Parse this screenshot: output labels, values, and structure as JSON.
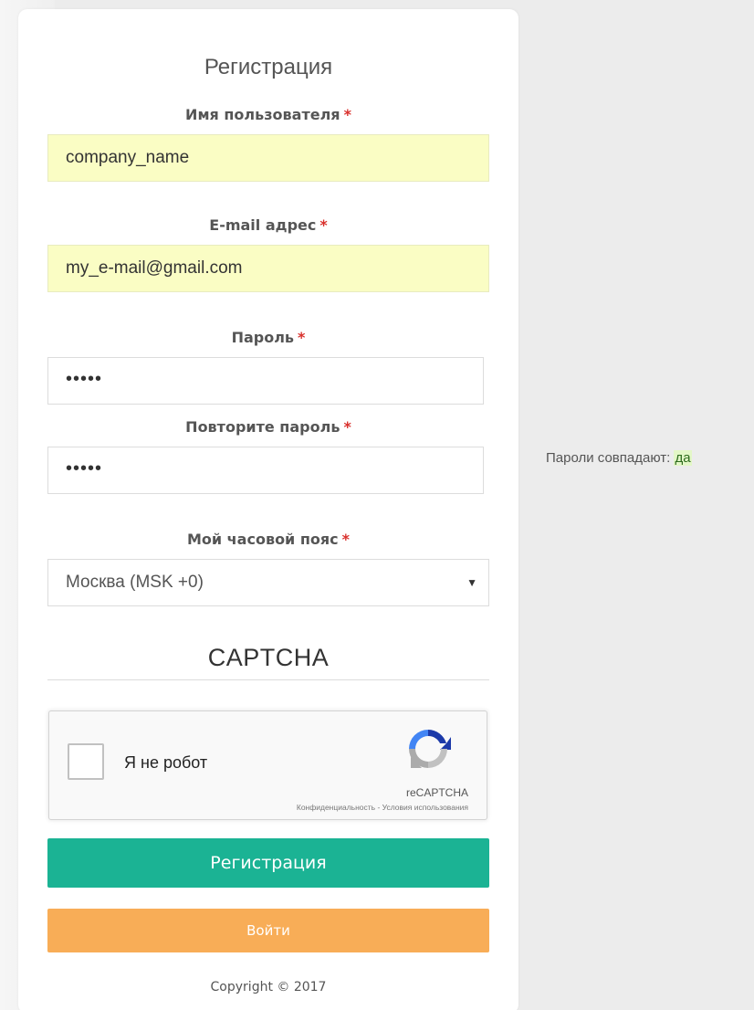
{
  "form": {
    "title": "Регистрация",
    "required_mark": "*",
    "username": {
      "label": "Имя пользователя",
      "value": "company_name"
    },
    "email": {
      "label": "E-mail адрес",
      "value": "my_e-mail@gmail.com"
    },
    "password": {
      "label": "Пароль",
      "value": "•••••"
    },
    "password_repeat": {
      "label": "Повторите пароль",
      "value": "•••••"
    },
    "timezone": {
      "label": "Мой часовой пояс",
      "value": "Москва (MSK +0)",
      "arrow": "▼"
    }
  },
  "captcha": {
    "title": "CAPTCHA",
    "checkbox_label": "Я не робот",
    "brand": "reCAPTCHA",
    "links": "Конфиденциальность - Условия использования"
  },
  "buttons": {
    "register": "Регистрация",
    "login": "Войти"
  },
  "footer": {
    "copyright": "Copyright © 2017"
  },
  "password_match": {
    "text": "Пароли совпадают: ",
    "status": "да"
  },
  "colors": {
    "register_button": "#1bb394",
    "login_button": "#f8ad57",
    "autofill_background": "#fafdc4",
    "required_mark": "#d9302c"
  }
}
